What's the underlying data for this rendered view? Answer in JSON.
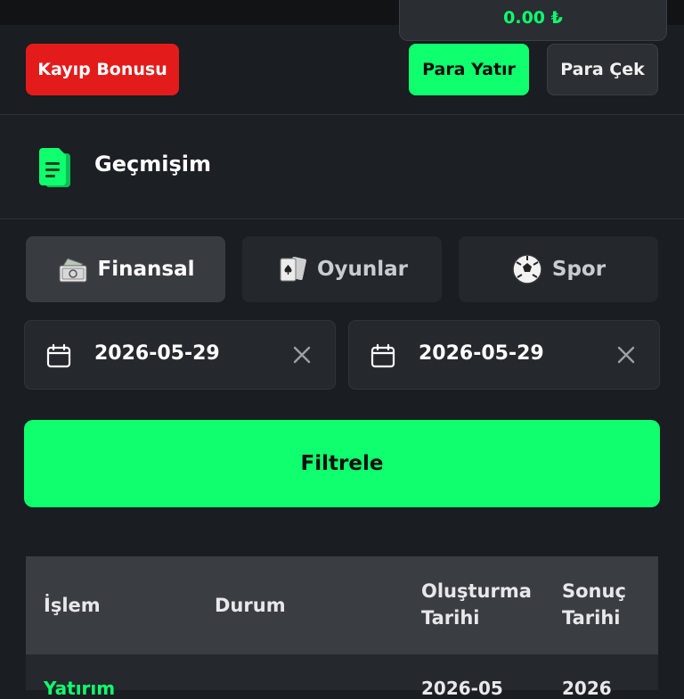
{
  "balance": {
    "value": "0.00 ₺"
  },
  "header": {
    "loss_bonus_label": "Kayıp Bonusu",
    "deposit_label": "Para Yatır",
    "withdraw_label": "Para Çek"
  },
  "section": {
    "title": "Geçmişim"
  },
  "tabs": [
    {
      "label": "Finansal",
      "icon": "money-icon",
      "active": true
    },
    {
      "label": "Oyunlar",
      "icon": "cards-icon",
      "active": false
    },
    {
      "label": "Spor",
      "icon": "soccer-ball-icon",
      "active": false
    }
  ],
  "filters": {
    "start_date": "2026-05-29",
    "end_date": "2026-05-29",
    "filter_label": "Filtrele"
  },
  "table": {
    "columns": [
      "İşlem",
      "Durum",
      "Oluşturma Tarihi",
      "Sonuç Tarihi"
    ],
    "rows": [
      {
        "operation": "Yatırım",
        "status": "",
        "created": "2026-05",
        "result": "2026"
      }
    ]
  },
  "colors": {
    "accent_green": "#10ff6e",
    "danger_red": "#e31b1b",
    "background": "#1a1d21"
  }
}
